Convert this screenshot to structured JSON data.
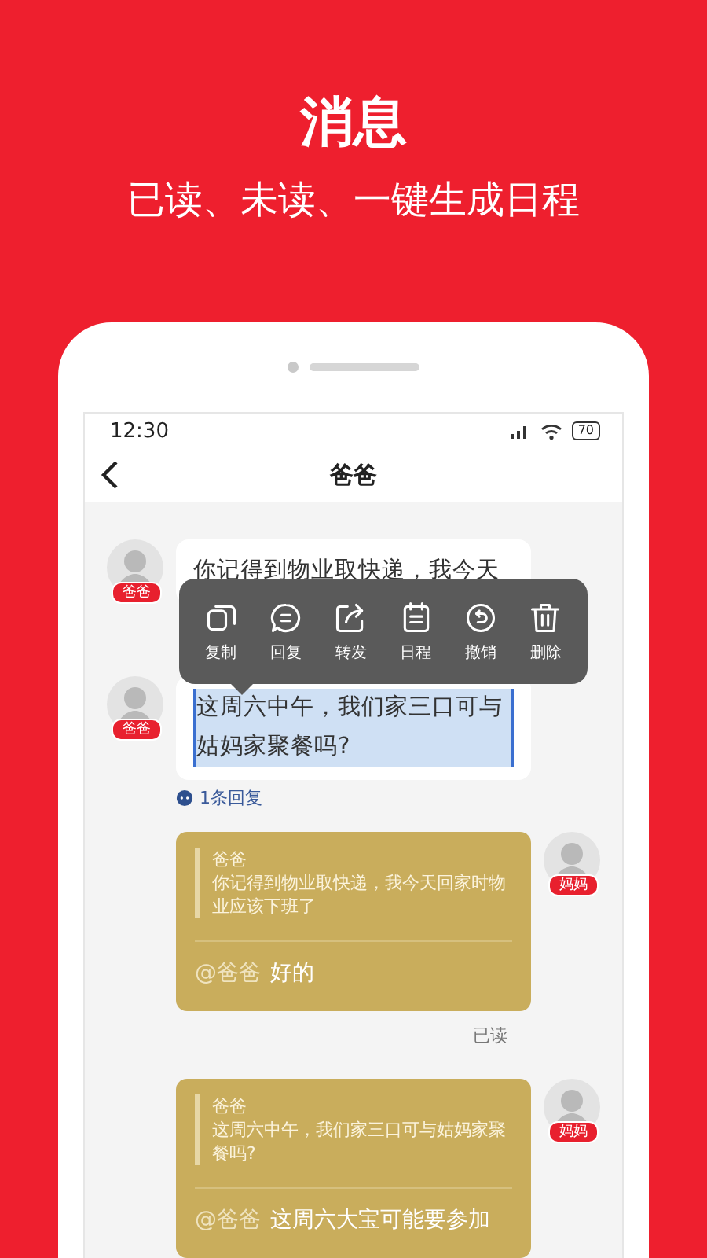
{
  "headline": "消息",
  "subheadline": "已读、未读、一键生成日程",
  "status_bar": {
    "time": "12:30",
    "battery": "70"
  },
  "nav": {
    "title": "爸爸"
  },
  "messages": [
    {
      "kind": "text",
      "avatar_label": "爸爸",
      "text": "你记得到物业取快递，我今天",
      "selected": false
    },
    {
      "kind": "text",
      "avatar_label": "爸爸",
      "text": "这周六中午，我们家三口可与姑妈家聚餐吗?",
      "selected": true,
      "reply_count": "1条回复"
    },
    {
      "kind": "quote",
      "avatar_label": "妈妈",
      "quote_author": "爸爸",
      "quote_text": "你记得到物业取快递，我今天回家时物业应该下班了",
      "mention": "@爸爸",
      "text": "好的",
      "read_status": "已读"
    },
    {
      "kind": "quote",
      "avatar_label": "妈妈",
      "quote_author": "爸爸",
      "quote_text": "这周六中午，我们家三口可与姑妈家聚餐吗?",
      "mention": "@爸爸",
      "text": "这周六大宝可能要参加"
    }
  ],
  "context_menu": [
    {
      "kind": "copy",
      "label": "复制"
    },
    {
      "kind": "reply",
      "label": "回复"
    },
    {
      "kind": "forward",
      "label": "转发"
    },
    {
      "kind": "schedule",
      "label": "日程"
    },
    {
      "kind": "recall",
      "label": "撤销"
    },
    {
      "kind": "delete",
      "label": "删除"
    }
  ]
}
